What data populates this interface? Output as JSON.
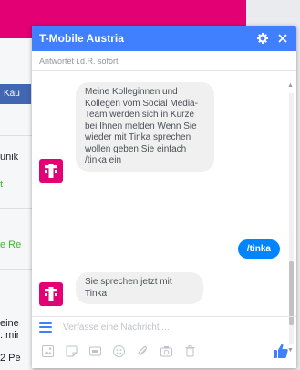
{
  "background": {
    "button_label": "Kau",
    "items": [
      "unik",
      "t",
      "e Re",
      "eine",
      ": mir",
      "2 Pe"
    ]
  },
  "chat": {
    "title": "T-Mobile Austria",
    "subtitle": "Antwortet i.d.R. sofort",
    "messages": [
      {
        "from": "page",
        "text": "Meine Kolleginnen und Kollegen vom Social Media-Team werden sich in Kürze bei Ihnen melden Wenn Sie wieder mit Tinka sprechen wollen geben Sie einfach /tinka ein"
      },
      {
        "from": "user",
        "text": "/tinka"
      },
      {
        "from": "page",
        "text": "Sie sprechen jetzt mit Tinka"
      }
    ],
    "composer_placeholder": "Verfasse eine Nachricht ...",
    "colors": {
      "header": "#4080ff",
      "brand": "#e20074",
      "outgoing": "#0084ff"
    }
  },
  "icons": {
    "settings": "gear-icon",
    "close": "close-icon",
    "menu": "menu-icon",
    "tools": [
      "image-icon",
      "sticker-icon",
      "gif-icon",
      "emoji-icon",
      "attachment-icon",
      "camera-icon",
      "trash-icon"
    ],
    "like": "thumbs-up-icon"
  }
}
